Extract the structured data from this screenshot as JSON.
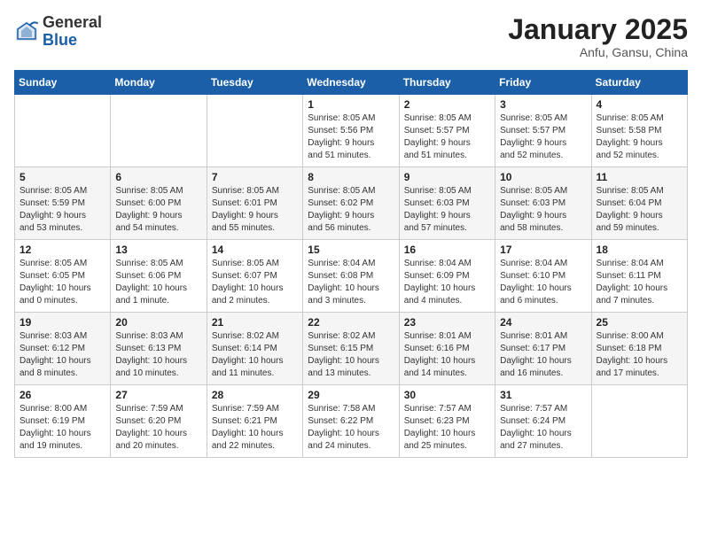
{
  "logo": {
    "general": "General",
    "blue": "Blue"
  },
  "header": {
    "title": "January 2025",
    "subtitle": "Anfu, Gansu, China"
  },
  "days_of_week": [
    "Sunday",
    "Monday",
    "Tuesday",
    "Wednesday",
    "Thursday",
    "Friday",
    "Saturday"
  ],
  "weeks": [
    [
      {
        "day": "",
        "info": ""
      },
      {
        "day": "",
        "info": ""
      },
      {
        "day": "",
        "info": ""
      },
      {
        "day": "1",
        "info": "Sunrise: 8:05 AM\nSunset: 5:56 PM\nDaylight: 9 hours\nand 51 minutes."
      },
      {
        "day": "2",
        "info": "Sunrise: 8:05 AM\nSunset: 5:57 PM\nDaylight: 9 hours\nand 51 minutes."
      },
      {
        "day": "3",
        "info": "Sunrise: 8:05 AM\nSunset: 5:57 PM\nDaylight: 9 hours\nand 52 minutes."
      },
      {
        "day": "4",
        "info": "Sunrise: 8:05 AM\nSunset: 5:58 PM\nDaylight: 9 hours\nand 52 minutes."
      }
    ],
    [
      {
        "day": "5",
        "info": "Sunrise: 8:05 AM\nSunset: 5:59 PM\nDaylight: 9 hours\nand 53 minutes."
      },
      {
        "day": "6",
        "info": "Sunrise: 8:05 AM\nSunset: 6:00 PM\nDaylight: 9 hours\nand 54 minutes."
      },
      {
        "day": "7",
        "info": "Sunrise: 8:05 AM\nSunset: 6:01 PM\nDaylight: 9 hours\nand 55 minutes."
      },
      {
        "day": "8",
        "info": "Sunrise: 8:05 AM\nSunset: 6:02 PM\nDaylight: 9 hours\nand 56 minutes."
      },
      {
        "day": "9",
        "info": "Sunrise: 8:05 AM\nSunset: 6:03 PM\nDaylight: 9 hours\nand 57 minutes."
      },
      {
        "day": "10",
        "info": "Sunrise: 8:05 AM\nSunset: 6:03 PM\nDaylight: 9 hours\nand 58 minutes."
      },
      {
        "day": "11",
        "info": "Sunrise: 8:05 AM\nSunset: 6:04 PM\nDaylight: 9 hours\nand 59 minutes."
      }
    ],
    [
      {
        "day": "12",
        "info": "Sunrise: 8:05 AM\nSunset: 6:05 PM\nDaylight: 10 hours\nand 0 minutes."
      },
      {
        "day": "13",
        "info": "Sunrise: 8:05 AM\nSunset: 6:06 PM\nDaylight: 10 hours\nand 1 minute."
      },
      {
        "day": "14",
        "info": "Sunrise: 8:05 AM\nSunset: 6:07 PM\nDaylight: 10 hours\nand 2 minutes."
      },
      {
        "day": "15",
        "info": "Sunrise: 8:04 AM\nSunset: 6:08 PM\nDaylight: 10 hours\nand 3 minutes."
      },
      {
        "day": "16",
        "info": "Sunrise: 8:04 AM\nSunset: 6:09 PM\nDaylight: 10 hours\nand 4 minutes."
      },
      {
        "day": "17",
        "info": "Sunrise: 8:04 AM\nSunset: 6:10 PM\nDaylight: 10 hours\nand 6 minutes."
      },
      {
        "day": "18",
        "info": "Sunrise: 8:04 AM\nSunset: 6:11 PM\nDaylight: 10 hours\nand 7 minutes."
      }
    ],
    [
      {
        "day": "19",
        "info": "Sunrise: 8:03 AM\nSunset: 6:12 PM\nDaylight: 10 hours\nand 8 minutes."
      },
      {
        "day": "20",
        "info": "Sunrise: 8:03 AM\nSunset: 6:13 PM\nDaylight: 10 hours\nand 10 minutes."
      },
      {
        "day": "21",
        "info": "Sunrise: 8:02 AM\nSunset: 6:14 PM\nDaylight: 10 hours\nand 11 minutes."
      },
      {
        "day": "22",
        "info": "Sunrise: 8:02 AM\nSunset: 6:15 PM\nDaylight: 10 hours\nand 13 minutes."
      },
      {
        "day": "23",
        "info": "Sunrise: 8:01 AM\nSunset: 6:16 PM\nDaylight: 10 hours\nand 14 minutes."
      },
      {
        "day": "24",
        "info": "Sunrise: 8:01 AM\nSunset: 6:17 PM\nDaylight: 10 hours\nand 16 minutes."
      },
      {
        "day": "25",
        "info": "Sunrise: 8:00 AM\nSunset: 6:18 PM\nDaylight: 10 hours\nand 17 minutes."
      }
    ],
    [
      {
        "day": "26",
        "info": "Sunrise: 8:00 AM\nSunset: 6:19 PM\nDaylight: 10 hours\nand 19 minutes."
      },
      {
        "day": "27",
        "info": "Sunrise: 7:59 AM\nSunset: 6:20 PM\nDaylight: 10 hours\nand 20 minutes."
      },
      {
        "day": "28",
        "info": "Sunrise: 7:59 AM\nSunset: 6:21 PM\nDaylight: 10 hours\nand 22 minutes."
      },
      {
        "day": "29",
        "info": "Sunrise: 7:58 AM\nSunset: 6:22 PM\nDaylight: 10 hours\nand 24 minutes."
      },
      {
        "day": "30",
        "info": "Sunrise: 7:57 AM\nSunset: 6:23 PM\nDaylight: 10 hours\nand 25 minutes."
      },
      {
        "day": "31",
        "info": "Sunrise: 7:57 AM\nSunset: 6:24 PM\nDaylight: 10 hours\nand 27 minutes."
      },
      {
        "day": "",
        "info": ""
      }
    ]
  ]
}
